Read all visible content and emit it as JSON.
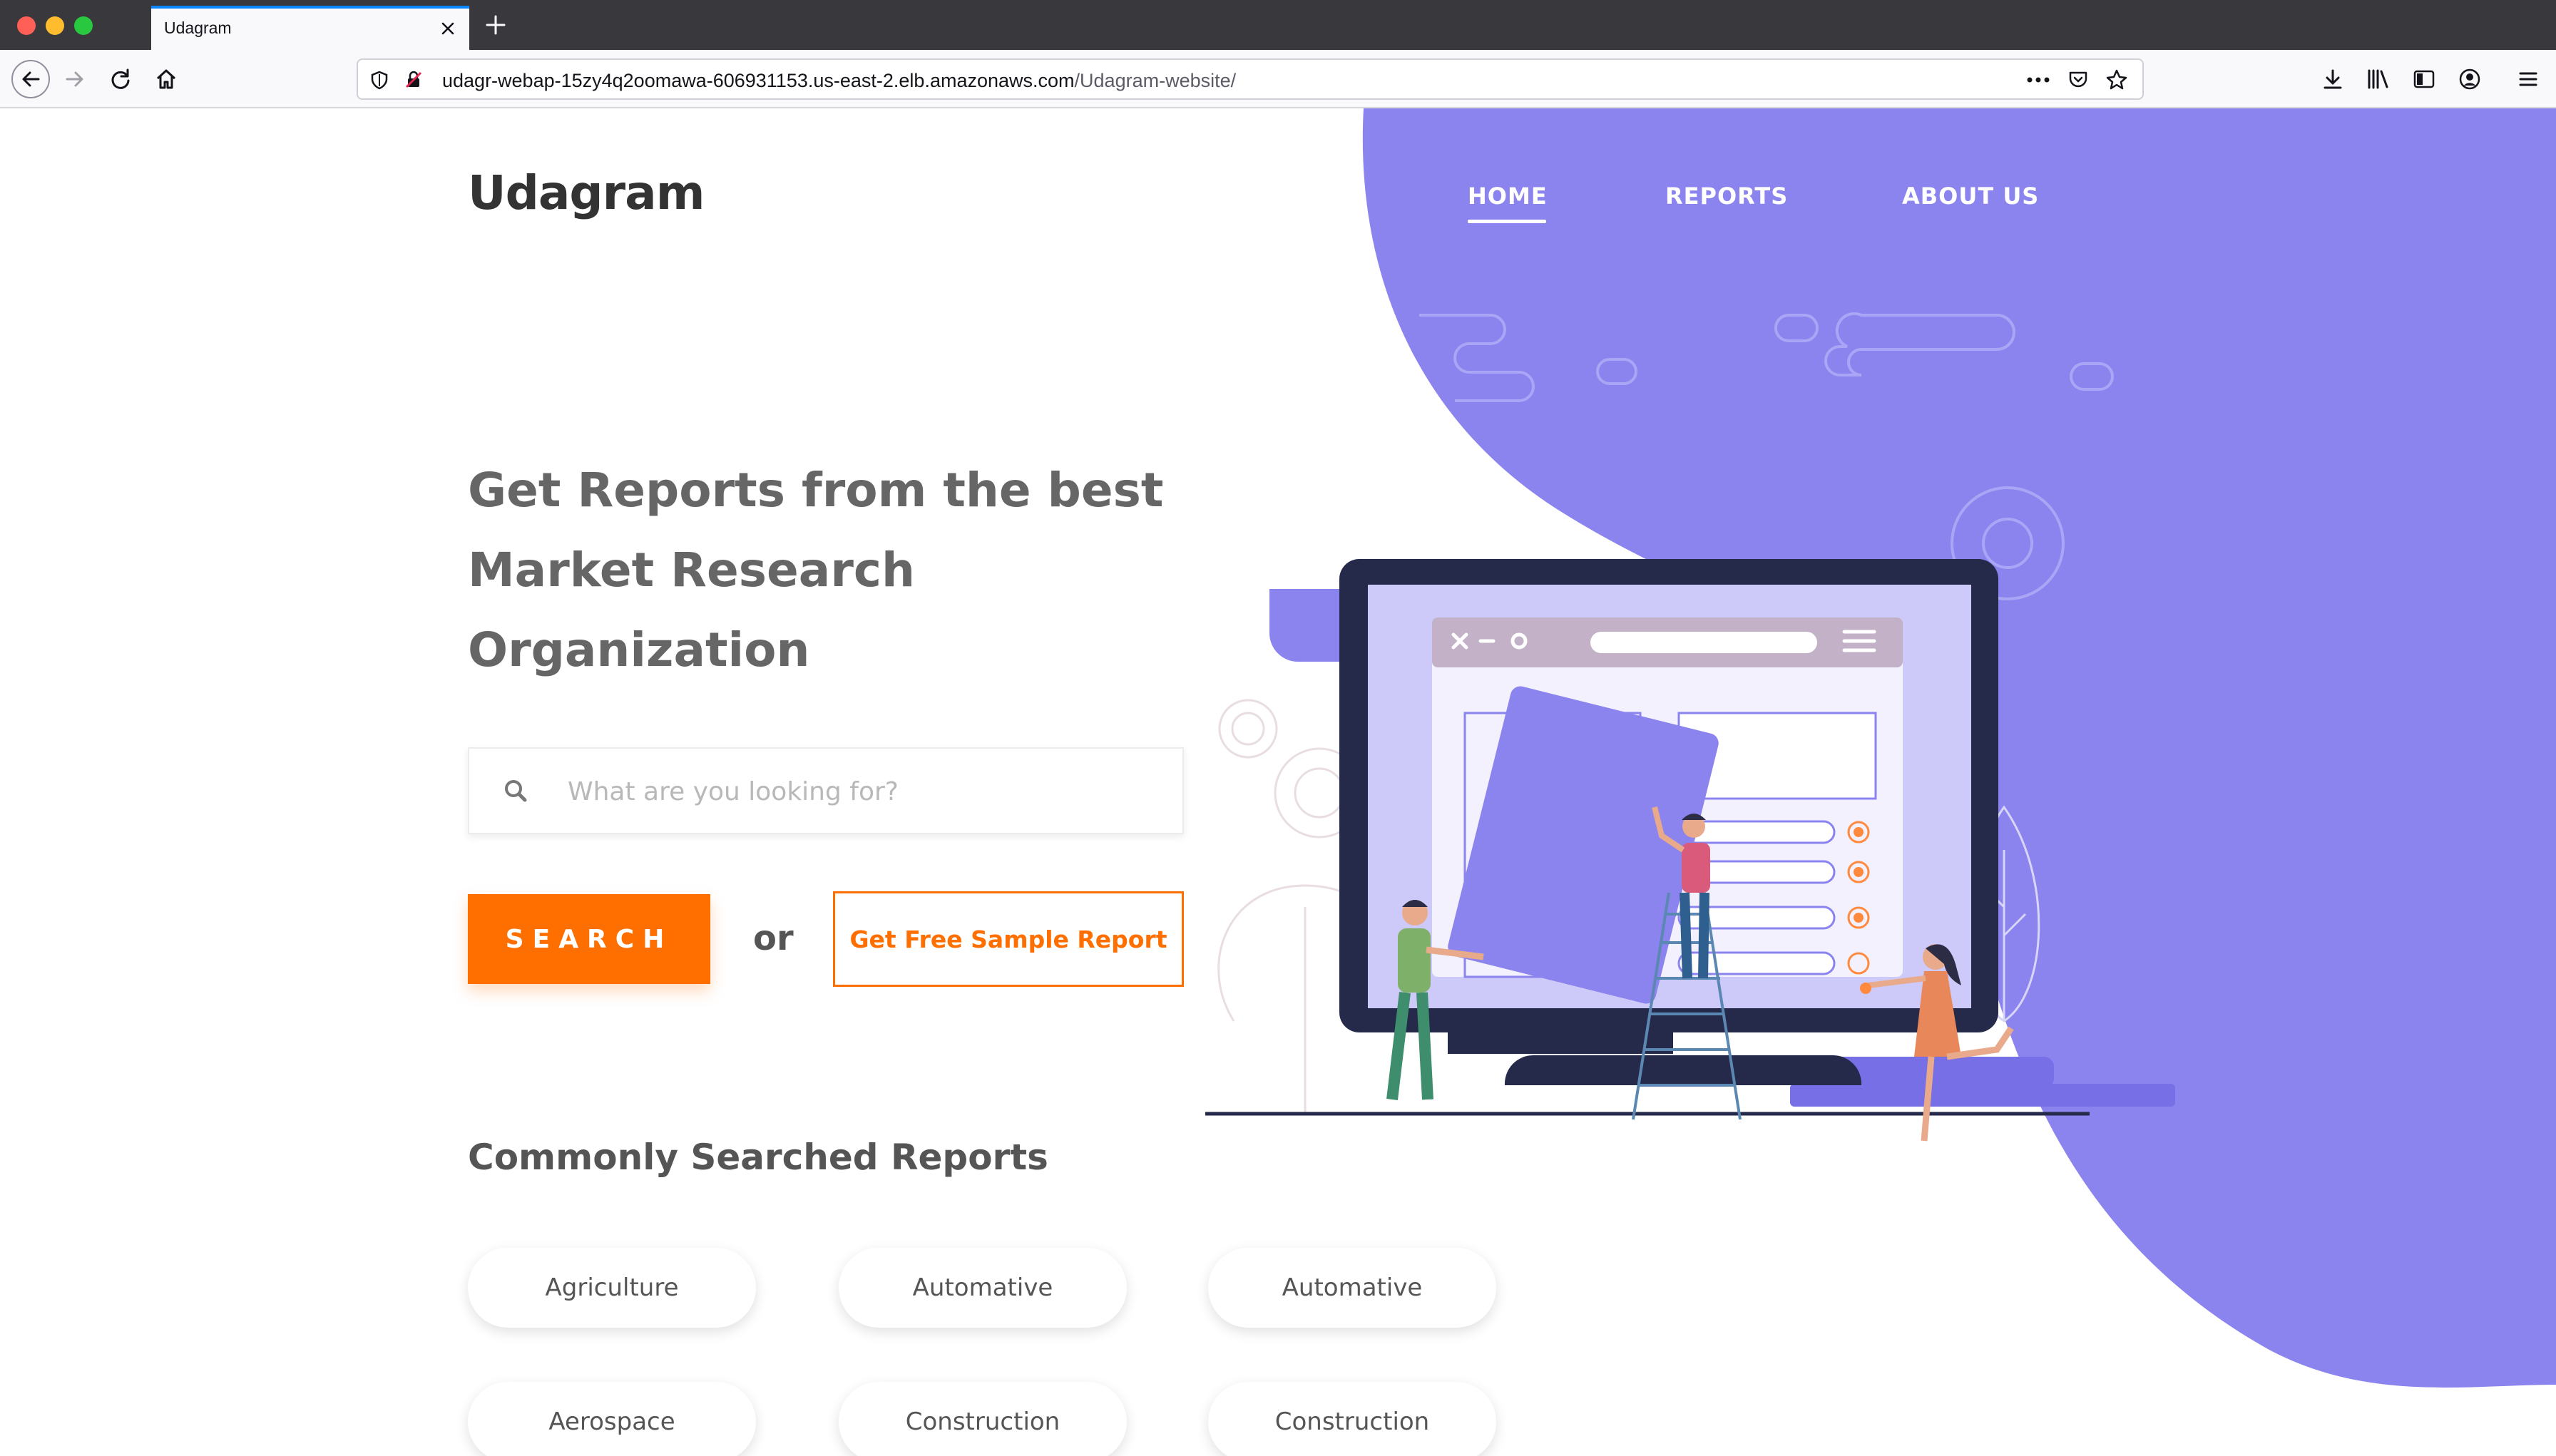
{
  "browser": {
    "tab_title": "Udagram",
    "url_host": "udagr-webap-15zy4q2oomawa-606931153.us-east-2.elb.amazonaws.com",
    "url_path": "/Udagram-website/"
  },
  "site": {
    "brand": "Udagram",
    "nav": {
      "home": "HOME",
      "reports": "REPORTS",
      "about": "ABOUT US"
    },
    "hero_title_lines": [
      "Get Reports from the best",
      "Market Research",
      "Organization"
    ],
    "search": {
      "placeholder": "What are you looking for?",
      "button": "SEARCH"
    },
    "or_text": "or",
    "sample_button": "Get Free Sample Report",
    "section_title": "Commonly Searched Reports",
    "categories": [
      "Agriculture",
      "Automative",
      "Automative",
      "Aerospace",
      "Construction",
      "Construction"
    ]
  },
  "colors": {
    "accent": "#ff6f00",
    "purple": "#8b84ef",
    "dark_navy": "#262a4a",
    "text_gray": "#666666"
  },
  "icons": [
    "close-icon",
    "plus-icon",
    "back-icon",
    "forward-icon",
    "reload-icon",
    "home-icon",
    "shield-icon",
    "lock-insecure-icon",
    "more-icon",
    "pocket-icon",
    "star-icon",
    "download-icon",
    "library-icon",
    "sidebar-icon",
    "account-icon",
    "menu-icon",
    "search-icon"
  ]
}
